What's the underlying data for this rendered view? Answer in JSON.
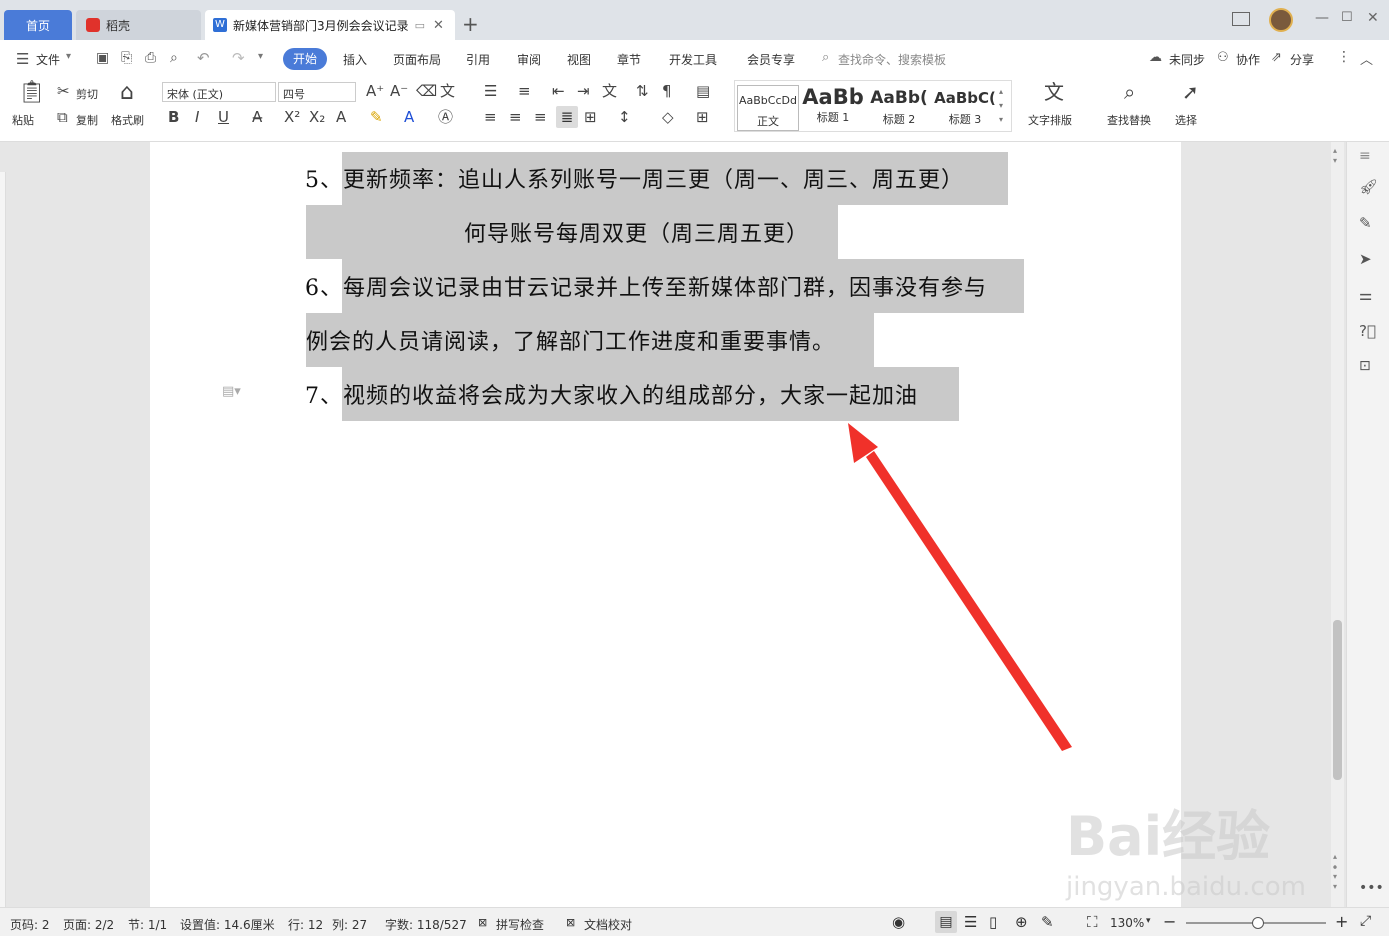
{
  "tabs": {
    "home": "首页",
    "daoke": "稻壳",
    "document": "新媒体营销部门3月例会会议记录"
  },
  "menu": {
    "file": "文件",
    "items": [
      "开始",
      "插入",
      "页面布局",
      "引用",
      "审阅",
      "视图",
      "章节",
      "开发工具",
      "会员专享"
    ],
    "search_placeholder": "查找命令、搜索模板",
    "sync": "未同步",
    "collab": "协作",
    "share": "分享"
  },
  "ribbon": {
    "paste": "粘贴",
    "cut": "剪切",
    "copy": "复制",
    "format_painter": "格式刷",
    "font_name": "宋体 (正文)",
    "font_size": "四号",
    "styles": [
      {
        "preview": "AaBbCcDd",
        "label": "正文"
      },
      {
        "preview": "AaBb",
        "label": "标题 1"
      },
      {
        "preview": "AaBb(",
        "label": "标题 2"
      },
      {
        "preview": "AaBbC(",
        "label": "标题 3"
      }
    ],
    "text_layout": "文字排版",
    "find_replace": "查找替换",
    "select": "选择"
  },
  "document": {
    "lines": [
      "5、更新频率：追山人系列账号一周三更（周一、周三、周五更）",
      "何导账号每周双更（周三周五更）",
      "6、每周会议记录由甘云记录并上传至新媒体部门群，因事没有参与",
      "例会的人员请阅读，了解部门工作进度和重要事情。",
      "7、视频的收益将会成为大家收入的组成部分，大家一起加油"
    ]
  },
  "status": {
    "page_no": "页码: 2",
    "pages": "页面: 2/2",
    "section": "节: 1/1",
    "setting": "设置值: 14.6厘米",
    "row": "行: 12",
    "col": "列: 27",
    "words": "字数: 118/527",
    "spell": "拼写检查",
    "proof": "文档校对",
    "zoom": "130%"
  },
  "watermark": {
    "brand": "Bai经验",
    "url": "jingyan.baidu.com"
  },
  "colors": {
    "accent": "#4a7bd8",
    "highlight": "#c9c9c9",
    "arrow": "#f0312a"
  }
}
